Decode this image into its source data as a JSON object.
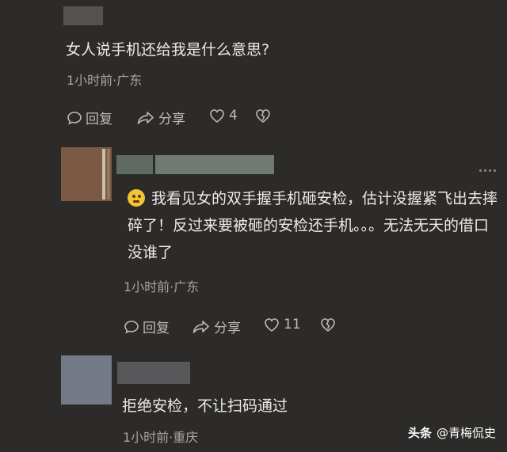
{
  "comment1": {
    "text": "女人说手机还给我是什么意思?",
    "meta": "1小时前·广东",
    "reply_label": "回复",
    "share_label": "分享",
    "like_count": "4"
  },
  "comment2": {
    "text": "我看见女的双手握手机砸安检，估计没握紧飞出去摔碎了！反过来要被砸的安检还手机。。。无法无天的借口没谁了",
    "meta": "1小时前·广东",
    "reply_label": "回复",
    "share_label": "分享",
    "like_count": "11",
    "emoji_icon": "face-emoji-icon"
  },
  "comment3": {
    "text": "拒绝安检，不让扫码通过",
    "meta": "1小时前·重庆"
  },
  "watermark": {
    "brand": "头条",
    "handle": "@青梅侃史"
  },
  "colors": {
    "background": "#2c2b29",
    "text": "#ecebe7",
    "meta": "#a7a5a0"
  }
}
